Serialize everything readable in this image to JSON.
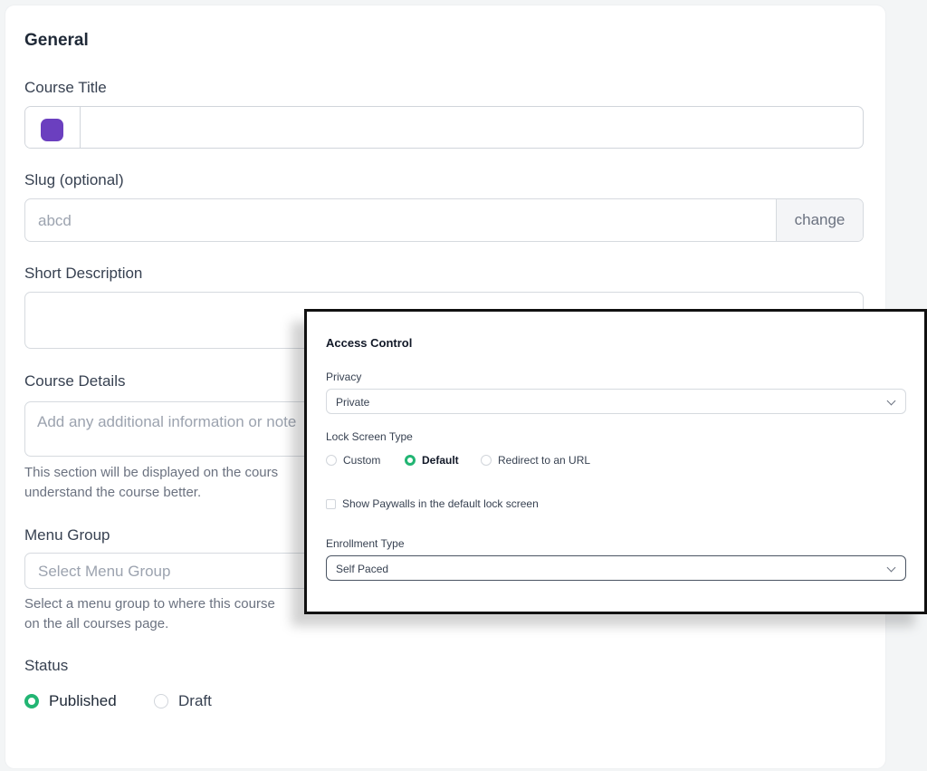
{
  "general": {
    "heading": "General",
    "course_title": {
      "label": "Course Title",
      "value": ""
    },
    "slug": {
      "label": "Slug (optional)",
      "placeholder": "abcd",
      "change_label": "change"
    },
    "short_description": {
      "label": "Short Description",
      "value": ""
    },
    "course_details": {
      "label": "Course Details",
      "placeholder": "Add any additional information or note",
      "help_line1": "This section will be displayed on the cours",
      "help_line2": "understand the course better."
    },
    "menu_group": {
      "label": "Menu Group",
      "placeholder": "Select Menu Group",
      "help_line1": "Select a menu group to where this course",
      "help_line2": "on the all courses page."
    },
    "status": {
      "label": "Status",
      "options": [
        {
          "label": "Published",
          "selected": true
        },
        {
          "label": "Draft",
          "selected": false
        }
      ]
    }
  },
  "access_control": {
    "title": "Access Control",
    "privacy": {
      "label": "Privacy",
      "value": "Private"
    },
    "lock_screen": {
      "label": "Lock Screen Type",
      "options": [
        {
          "label": "Custom",
          "selected": false
        },
        {
          "label": "Default",
          "selected": true
        },
        {
          "label": "Redirect to an URL",
          "selected": false
        }
      ]
    },
    "paywall_checkbox": {
      "label": "Show Paywalls in the default lock screen",
      "checked": false
    },
    "enrollment": {
      "label": "Enrollment Type",
      "value": "Self Paced"
    }
  },
  "colors": {
    "accent_green": "#22b573",
    "emoji_purple": "#6b3fbf"
  }
}
